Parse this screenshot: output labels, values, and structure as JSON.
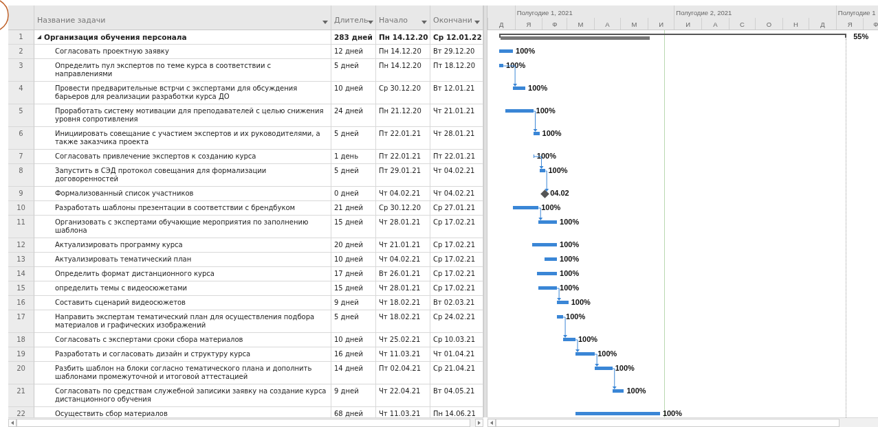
{
  "columns": [
    {
      "label": "Название задачи"
    },
    {
      "label": "Длитель"
    },
    {
      "label": "Начало"
    },
    {
      "label": "Окончани"
    }
  ],
  "timescale": {
    "halves": [
      {
        "label": "Полугодие 1, 2021"
      },
      {
        "label": "Полугодие 2, 2021"
      },
      {
        "label": "Полугодие 1"
      }
    ],
    "months": [
      {
        "label": "Д"
      },
      {
        "label": "Я"
      },
      {
        "label": "Ф"
      },
      {
        "label": "М"
      },
      {
        "label": "А"
      },
      {
        "label": "М"
      },
      {
        "label": "И"
      },
      {
        "label": "И"
      },
      {
        "label": "А"
      },
      {
        "label": "С"
      },
      {
        "label": "О"
      },
      {
        "label": "Н"
      },
      {
        "label": "Д"
      },
      {
        "label": "Я"
      },
      {
        "label": "Ф"
      }
    ]
  },
  "tasks": [
    {
      "id": "1",
      "name": "Организация обучения персонала",
      "duration": "283 дней",
      "start": "Пн 14.12.20",
      "finish": "Ср 12.01.22",
      "kind": "summary",
      "expanded": true,
      "level": 0.43,
      "bar_label": "55%"
    },
    {
      "id": "2",
      "name": "Согласовать проектную заявку",
      "duration": "12 дней",
      "start": "Пн 14.12.20",
      "finish": "Вт 29.12.20",
      "kind": "task",
      "bar_label": "100%"
    },
    {
      "id": "3",
      "name": "Определить пул экспертов по теме курса в соответствии с направлениями",
      "duration": "5 дней",
      "start": "Пн 14.12.20",
      "finish": "Пт 18.12.20",
      "kind": "task",
      "bar_label": "100%"
    },
    {
      "id": "4",
      "name": "Провести предварительные встрчи с экспертами для обсуждения барьеров для реализации разработки курса ДО",
      "duration": "10 дней",
      "start": "Ср 30.12.20",
      "finish": "Вт 12.01.21",
      "kind": "task",
      "bar_label": "100%"
    },
    {
      "id": "5",
      "name": "Проработать систему мотивации для преподавателей с целью снижения уровня сопротивления",
      "duration": "24 дней",
      "start": "Пн 21.12.20",
      "finish": "Чт 21.01.21",
      "kind": "task",
      "bar_label": "100%"
    },
    {
      "id": "6",
      "name": "Инициировать совещание с участием экспертов и их руководителями, а также заказчика проекта",
      "duration": "5 дней",
      "start": "Пт 22.01.21",
      "finish": "Чт 28.01.21",
      "kind": "task",
      "bar_label": "100%"
    },
    {
      "id": "7",
      "name": "Согласовать привлечение экспертов к созданию курса",
      "duration": "1 день",
      "start": "Пт 22.01.21",
      "finish": "Пт 22.01.21",
      "kind": "task",
      "bar_label": "100%"
    },
    {
      "id": "8",
      "name": "Запустить в СЭД протокол совещания для формализации договоренностей",
      "duration": "5 дней",
      "start": "Пт 29.01.21",
      "finish": "Чт 04.02.21",
      "kind": "task",
      "bar_label": "100%"
    },
    {
      "id": "9",
      "name": "Формализованный список участников",
      "duration": "0 дней",
      "start": "Чт 04.02.21",
      "finish": "Чт 04.02.21",
      "kind": "milestone",
      "bar_label": "04.02"
    },
    {
      "id": "10",
      "name": "Разработать шаблоны презентации в соответствии с брендбуком",
      "duration": "21 дней",
      "start": "Ср 30.12.20",
      "finish": "Ср 27.01.21",
      "kind": "task",
      "bar_label": "100%"
    },
    {
      "id": "11",
      "name": "Организовать с экспертами обучающие мероприятия по заполнению шаблона",
      "duration": "15 дней",
      "start": "Чт 28.01.21",
      "finish": "Ср 17.02.21",
      "kind": "task",
      "bar_label": "100%"
    },
    {
      "id": "12",
      "name": "Актуализировать программу курса",
      "duration": "20 дней",
      "start": "Чт 21.01.21",
      "finish": "Ср 17.02.21",
      "kind": "task",
      "bar_label": "100%"
    },
    {
      "id": "13",
      "name": "Актуализировать тематический план",
      "duration": "10 дней",
      "start": "Чт 04.02.21",
      "finish": "Ср 17.02.21",
      "kind": "task",
      "bar_label": "100%"
    },
    {
      "id": "14",
      "name": "Определить формат дистанционного курса",
      "duration": "17 дней",
      "start": "Вт 26.01.21",
      "finish": "Ср 17.02.21",
      "kind": "task",
      "bar_label": "100%"
    },
    {
      "id": "15",
      "name": "определить темы с видеосюжетами",
      "duration": "15 дней",
      "start": "Чт 28.01.21",
      "finish": "Ср 17.02.21",
      "kind": "task",
      "bar_label": "100%"
    },
    {
      "id": "16",
      "name": "Составить сценарий видеосюжетов",
      "duration": "9 дней",
      "start": "Чт 18.02.21",
      "finish": "Вт 02.03.21",
      "kind": "task",
      "bar_label": "100%"
    },
    {
      "id": "17",
      "name": "Направить экспертам тематический план для осуществления подбора материалов и графических изображений",
      "duration": "5 дней",
      "start": "Чт 18.02.21",
      "finish": "Ср 24.02.21",
      "kind": "task",
      "bar_label": "100%"
    },
    {
      "id": "18",
      "name": "Согласовать с экспертами сроки сбора материалов",
      "duration": "10 дней",
      "start": "Чт 25.02.21",
      "finish": "Ср 10.03.21",
      "kind": "task",
      "bar_label": "100%"
    },
    {
      "id": "19",
      "name": "Разработать и согласовать дизайн и структуру курса",
      "duration": "16 дней",
      "start": "Чт 11.03.21",
      "finish": "Чт 01.04.21",
      "kind": "task",
      "bar_label": "100%"
    },
    {
      "id": "20",
      "name": "Разбить шаблон на блоки согласно тематического плана и дополнить шаблонами промежуточной и итоговой аттестацией",
      "duration": "14 дней",
      "start": "Пт 02.04.21",
      "finish": "Ср 21.04.21",
      "kind": "task",
      "bar_label": "100%"
    },
    {
      "id": "21",
      "name": "Согласовать по средствам служебной записики заявку на создание курса дистанционного обучения",
      "duration": "9 дней",
      "start": "Чт 22.04.21",
      "finish": "Вт 04.05.21",
      "kind": "task",
      "bar_label": "100%"
    },
    {
      "id": "22",
      "name": "Осуществить сбор материалов",
      "duration": "68 дней",
      "start": "Чт 11.03.21",
      "finish": "Пн 14.06.21",
      "kind": "task",
      "bar_label": "100%"
    }
  ]
}
